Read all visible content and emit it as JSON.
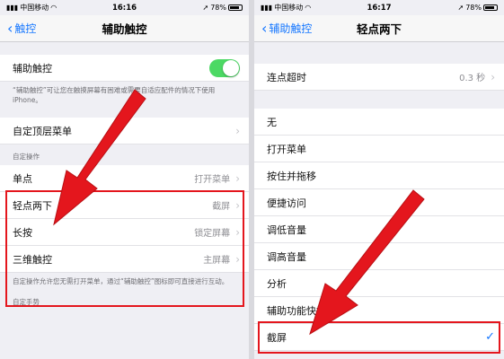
{
  "left": {
    "status": {
      "carrier": "中国移动",
      "time": "16:16",
      "battery": "78%"
    },
    "nav": {
      "back": "触控",
      "title": "辅助触控"
    },
    "toggle_row": {
      "label": "辅助触控",
      "on": true
    },
    "toggle_note": "“辅助触控”可让您在触摸屏幕有困难或需要自适应配件的情况下使用 iPhone。",
    "top_menu": {
      "label": "自定顶层菜单"
    },
    "custom_actions_header": "自定操作",
    "actions": [
      {
        "label": "单点",
        "value": "打开菜单"
      },
      {
        "label": "轻点两下",
        "value": "截屏"
      },
      {
        "label": "长按",
        "value": "锁定屏幕"
      },
      {
        "label": "三维触控",
        "value": "主屏幕"
      }
    ],
    "actions_note": "自定操作允许您无需打开菜单，通过“辅助触控”图标即可直接进行互动。",
    "gestures_header": "自定手势"
  },
  "right": {
    "status": {
      "carrier": "中国移动",
      "time": "16:17",
      "battery": "78%"
    },
    "nav": {
      "back": "辅助触控",
      "title": "轻点两下"
    },
    "timeout": {
      "label": "连点超时",
      "value": "0.3 秒"
    },
    "options": [
      "无",
      "打开菜单",
      "按住并拖移",
      "便捷访问",
      "调低音量",
      "调高音量",
      "分析",
      "辅助功能快捷键",
      "截屏"
    ],
    "selected_index": 8
  },
  "colors": {
    "accent": "#1677ff",
    "highlight": "#e4161d",
    "toggle_on": "#4cd964"
  }
}
